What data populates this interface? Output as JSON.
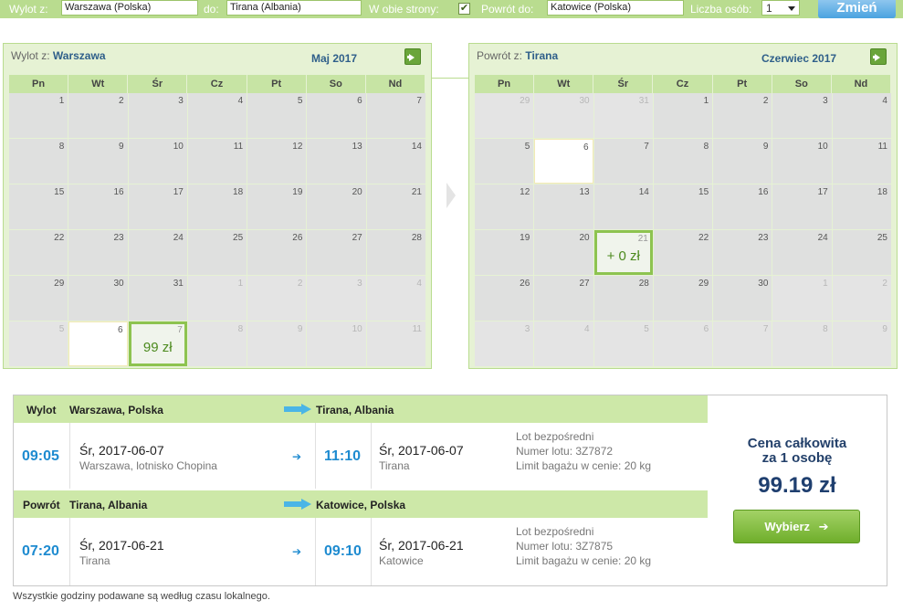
{
  "search": {
    "from_label": "Wylot z:",
    "from_value": "Warszawa (Polska)",
    "to_label": "do:",
    "to_value": "Tirana (Albania)",
    "roundtrip_label": "W obie strony:",
    "roundtrip_checked": "✔",
    "return_label": "Powrót do:",
    "return_value": "Katowice (Polska)",
    "pax_label": "Liczba osób:",
    "pax_value": "1",
    "change_button": "Zmień"
  },
  "weekdays": [
    "Pn",
    "Wt",
    "Śr",
    "Cz",
    "Pt",
    "So",
    "Nd"
  ],
  "outbound_calendar": {
    "title_prefix": "Wylot z:",
    "title_city": "Warszawa",
    "month": "Maj 2017",
    "days": [
      {
        "n": "1",
        "type": "cur"
      },
      {
        "n": "2",
        "type": "cur"
      },
      {
        "n": "3",
        "type": "cur"
      },
      {
        "n": "4",
        "type": "cur"
      },
      {
        "n": "5",
        "type": "cur"
      },
      {
        "n": "6",
        "type": "cur"
      },
      {
        "n": "7",
        "type": "cur"
      },
      {
        "n": "8",
        "type": "cur"
      },
      {
        "n": "9",
        "type": "cur"
      },
      {
        "n": "10",
        "type": "cur"
      },
      {
        "n": "11",
        "type": "cur"
      },
      {
        "n": "12",
        "type": "cur"
      },
      {
        "n": "13",
        "type": "cur"
      },
      {
        "n": "14",
        "type": "cur"
      },
      {
        "n": "15",
        "type": "cur"
      },
      {
        "n": "16",
        "type": "cur"
      },
      {
        "n": "17",
        "type": "cur"
      },
      {
        "n": "18",
        "type": "cur"
      },
      {
        "n": "19",
        "type": "cur"
      },
      {
        "n": "20",
        "type": "cur"
      },
      {
        "n": "21",
        "type": "cur"
      },
      {
        "n": "22",
        "type": "cur"
      },
      {
        "n": "23",
        "type": "cur"
      },
      {
        "n": "24",
        "type": "cur"
      },
      {
        "n": "25",
        "type": "cur"
      },
      {
        "n": "26",
        "type": "cur"
      },
      {
        "n": "27",
        "type": "cur"
      },
      {
        "n": "28",
        "type": "cur"
      },
      {
        "n": "29",
        "type": "cur"
      },
      {
        "n": "30",
        "type": "cur"
      },
      {
        "n": "31",
        "type": "cur"
      },
      {
        "n": "1",
        "type": "other"
      },
      {
        "n": "2",
        "type": "other"
      },
      {
        "n": "3",
        "type": "other"
      },
      {
        "n": "4",
        "type": "other"
      },
      {
        "n": "5",
        "type": "other"
      },
      {
        "n": "6",
        "type": "blank"
      },
      {
        "n": "7",
        "type": "sel",
        "price": "99 zł"
      },
      {
        "n": "8",
        "type": "other"
      },
      {
        "n": "9",
        "type": "other"
      },
      {
        "n": "10",
        "type": "other"
      },
      {
        "n": "11",
        "type": "other"
      }
    ]
  },
  "return_calendar": {
    "title_prefix": "Powrót z:",
    "title_city": "Tirana",
    "month": "Czerwiec 2017",
    "days": [
      {
        "n": "29",
        "type": "other"
      },
      {
        "n": "30",
        "type": "other"
      },
      {
        "n": "31",
        "type": "other"
      },
      {
        "n": "1",
        "type": "cur"
      },
      {
        "n": "2",
        "type": "cur"
      },
      {
        "n": "3",
        "type": "cur"
      },
      {
        "n": "4",
        "type": "cur"
      },
      {
        "n": "5",
        "type": "cur"
      },
      {
        "n": "6",
        "type": "blank"
      },
      {
        "n": "7",
        "type": "cur"
      },
      {
        "n": "8",
        "type": "cur"
      },
      {
        "n": "9",
        "type": "cur"
      },
      {
        "n": "10",
        "type": "cur"
      },
      {
        "n": "11",
        "type": "cur"
      },
      {
        "n": "12",
        "type": "cur"
      },
      {
        "n": "13",
        "type": "cur"
      },
      {
        "n": "14",
        "type": "cur"
      },
      {
        "n": "15",
        "type": "cur"
      },
      {
        "n": "16",
        "type": "cur"
      },
      {
        "n": "17",
        "type": "cur"
      },
      {
        "n": "18",
        "type": "cur"
      },
      {
        "n": "19",
        "type": "cur"
      },
      {
        "n": "20",
        "type": "cur"
      },
      {
        "n": "21",
        "type": "sel",
        "price": "+ 0 zł"
      },
      {
        "n": "22",
        "type": "cur"
      },
      {
        "n": "23",
        "type": "cur"
      },
      {
        "n": "24",
        "type": "cur"
      },
      {
        "n": "25",
        "type": "cur"
      },
      {
        "n": "26",
        "type": "cur"
      },
      {
        "n": "27",
        "type": "cur"
      },
      {
        "n": "28",
        "type": "cur"
      },
      {
        "n": "29",
        "type": "cur"
      },
      {
        "n": "30",
        "type": "cur"
      },
      {
        "n": "1",
        "type": "other"
      },
      {
        "n": "2",
        "type": "other"
      },
      {
        "n": "3",
        "type": "other"
      },
      {
        "n": "4",
        "type": "other"
      },
      {
        "n": "5",
        "type": "other"
      },
      {
        "n": "6",
        "type": "other"
      },
      {
        "n": "7",
        "type": "other"
      },
      {
        "n": "8",
        "type": "other"
      },
      {
        "n": "9",
        "type": "other"
      }
    ]
  },
  "outbound_leg": {
    "label": "Wylot",
    "from": "Warszawa, Polska",
    "to": "Tirana, Albania",
    "dep_time": "09:05",
    "dep_date": "Śr, 2017-06-07",
    "dep_place": "Warszawa, lotnisko Chopina",
    "arr_time": "11:10",
    "arr_date": "Śr, 2017-06-07",
    "arr_place": "Tirana",
    "info_type": "Lot bezpośredni",
    "info_flight": "Numer lotu: 3Z7872",
    "info_baggage": "Limit bagażu w cenie: 20 kg"
  },
  "return_leg": {
    "label": "Powrót",
    "from": "Tirana, Albania",
    "to": "Katowice, Polska",
    "dep_time": "07:20",
    "dep_date": "Śr, 2017-06-21",
    "dep_place": "Tirana",
    "arr_time": "09:10",
    "arr_date": "Śr, 2017-06-21",
    "arr_place": "Katowice",
    "info_type": "Lot bezpośredni",
    "info_flight": "Numer lotu: 3Z7875",
    "info_baggage": "Limit bagażu w cenie: 20 kg"
  },
  "price": {
    "title_line1": "Cena całkowita",
    "title_line2": "za 1 osobę",
    "amount": "99.19 zł",
    "choose_button": "Wybierz"
  },
  "footnote": "Wszystkie godziny podawane są według czasu lokalnego.",
  "colors": {
    "bar_green": "#b9dc8f",
    "accent_blue": "#1e8bd0",
    "price_green": "#4c8a1e"
  }
}
